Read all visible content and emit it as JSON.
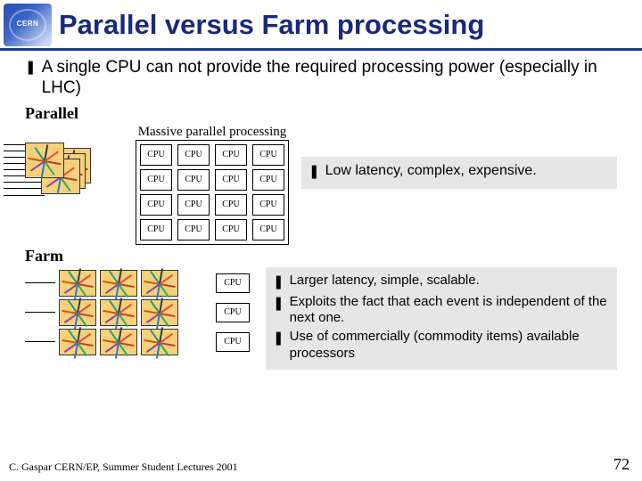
{
  "header": {
    "logo_text": "CERN",
    "title": "Parallel versus Farm processing"
  },
  "lead": "A single CPU can not provide the required processing power (especially in LHC)",
  "parallel": {
    "label": "Parallel",
    "subhead": "Massive parallel processing",
    "cpu_label": "CPU",
    "note": "Low latency, complex, expensive."
  },
  "farm": {
    "label": "Farm",
    "cpu_label": "CPU",
    "notes": [
      "Larger latency, simple, scalable.",
      "Exploits the fact that each event is independent of the next one.",
      "Use of commercially (commodity items) available processors"
    ]
  },
  "footer": {
    "credit": "C. Gaspar CERN/EP, Summer Student Lectures 2001",
    "page": "72"
  },
  "glyph": {
    "z": "❚"
  }
}
